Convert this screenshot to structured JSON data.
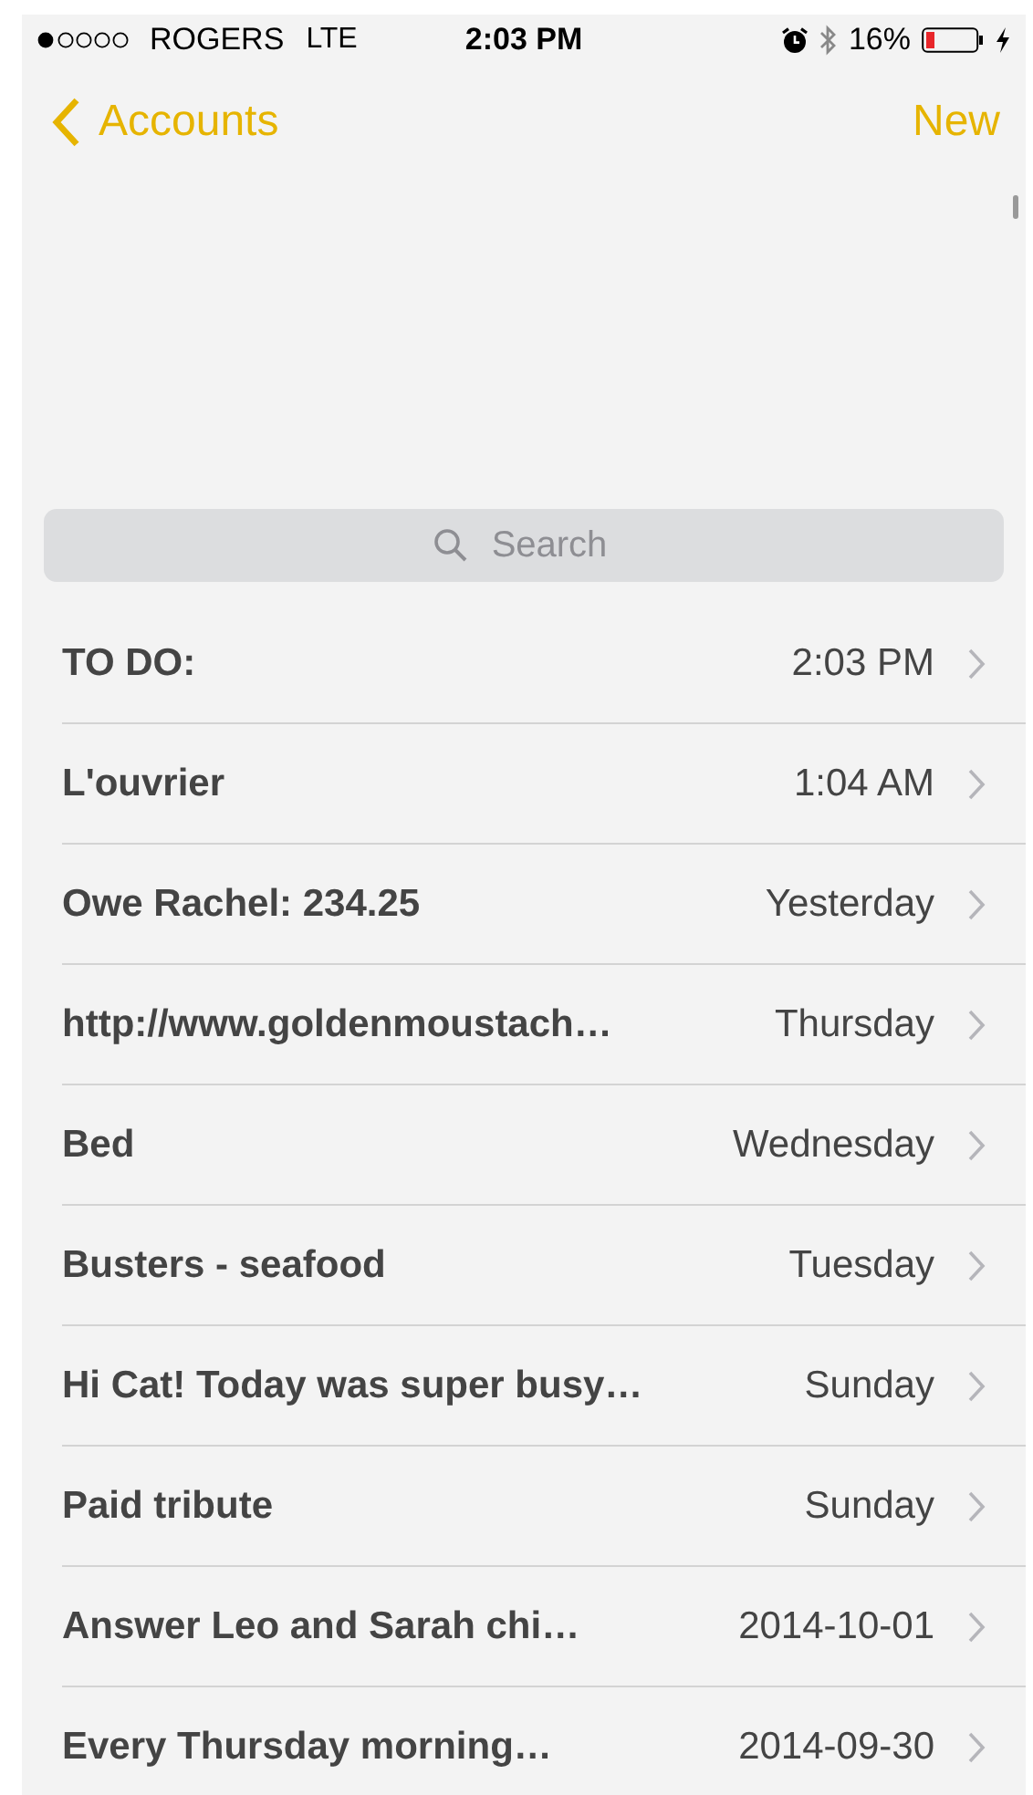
{
  "status_bar": {
    "carrier": "ROGERS",
    "network": "LTE",
    "time": "2:03 PM",
    "battery_percent": "16%"
  },
  "nav": {
    "back_label": "Accounts",
    "action_label": "New"
  },
  "search": {
    "placeholder": "Search"
  },
  "notes": [
    {
      "title": "TO DO:",
      "date": "2:03 PM"
    },
    {
      "title": "L'ouvrier",
      "date": "1:04 AM"
    },
    {
      "title": "Owe Rachel: 234.25",
      "date": "Yesterday"
    },
    {
      "title": "http://www.goldenmoustach…",
      "date": "Thursday"
    },
    {
      "title": "Bed",
      "date": "Wednesday"
    },
    {
      "title": "Busters  - seafood",
      "date": "Tuesday"
    },
    {
      "title": "Hi Cat! Today was super busy…",
      "date": "Sunday"
    },
    {
      "title": "Paid tribute",
      "date": "Sunday"
    },
    {
      "title": "Answer Leo and Sarah chi…",
      "date": "2014-10-01"
    },
    {
      "title": "Every Thursday morning…",
      "date": "2014-09-30"
    }
  ]
}
